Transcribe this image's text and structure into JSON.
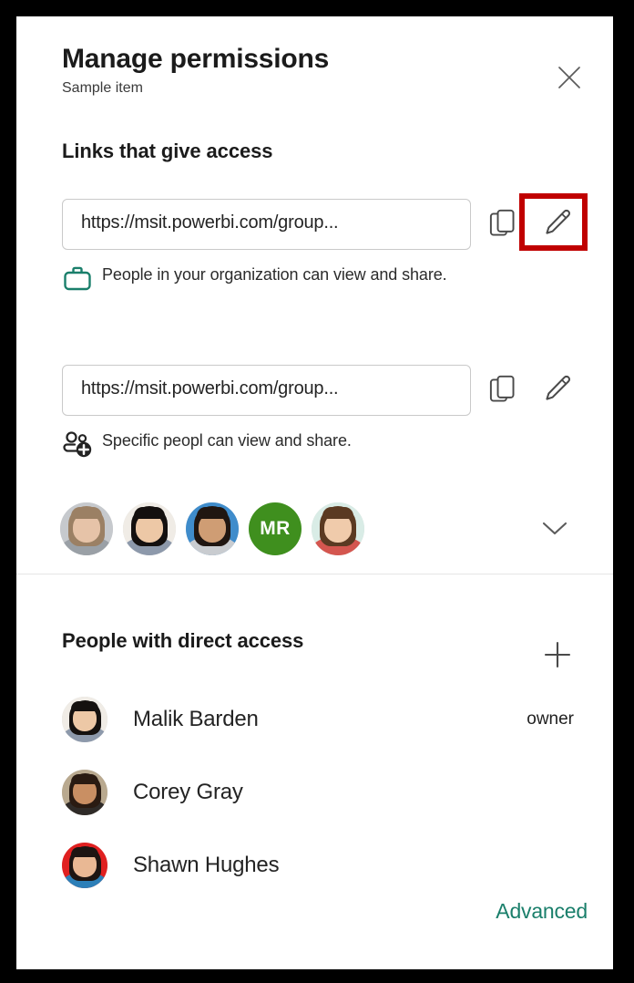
{
  "window": {
    "title": "Manage permissions",
    "subtitle": "Sample item",
    "close_label": "Close"
  },
  "links_section": {
    "title": "Links that give access",
    "links": [
      {
        "url": "https://msit.powerbi.com/group...",
        "description": "People in your organization can view and share.",
        "scope_icon": "briefcase-icon",
        "copy_label": "Copy link",
        "edit_label": "Edit link",
        "highlighted": true
      },
      {
        "url": "https://msit.powerbi.com/group...",
        "description": "Specific peopl can view and share.",
        "scope_icon": "people-add-icon",
        "copy_label": "Copy link",
        "edit_label": "Edit link",
        "highlighted": false
      }
    ],
    "avatars": [
      {
        "type": "photo",
        "tone": "#b9bcc0",
        "hair": "#9b8064",
        "skin": "#e6c3a8",
        "shirt": "#9aa0a6",
        "bg": "#c6c9cd"
      },
      {
        "type": "photo",
        "tone": "#1c1c1c",
        "hair": "#14100f",
        "skin": "#edc8a6",
        "shirt": "#8d99ab",
        "bg": "#f0ece6"
      },
      {
        "type": "photo",
        "tone": "#3a7fc1",
        "hair": "#201611",
        "skin": "#cf9d74",
        "shirt": "#c9ccd0",
        "bg": "#3f8ccb"
      },
      {
        "type": "initials",
        "initials": "MR",
        "bg": "#3f8f1e"
      },
      {
        "type": "photo",
        "tone": "#cfe3dd",
        "hair": "#5b3a22",
        "skin": "#f0cbab",
        "shirt": "#d4564f",
        "bg": "#d9ece6"
      }
    ],
    "expand_label": "Show more"
  },
  "direct_access": {
    "title": "People with direct access",
    "add_label": "Add people",
    "people": [
      {
        "name": "Malik Barden",
        "role": "owner",
        "hair": "#15110f",
        "skin": "#edc8a6",
        "shirt": "#8d99ab",
        "bg": "#f0ece6"
      },
      {
        "name": "Corey Gray",
        "role": "",
        "hair": "#2a1b12",
        "skin": "#c98f63",
        "shirt": "#2f2b28",
        "bg": "#b9a98f"
      },
      {
        "name": "Shawn Hughes",
        "role": "",
        "hair": "#1d1512",
        "skin": "#e9b894",
        "shirt": "#2c7fb8",
        "bg": "#e02020"
      }
    ]
  },
  "footer": {
    "advanced_label": "Advanced",
    "advanced_color": "#1a7f6b"
  },
  "theme": {
    "accent_teal": "#1a7f6b",
    "highlight_red": "#c00000",
    "frame": "#000000"
  }
}
